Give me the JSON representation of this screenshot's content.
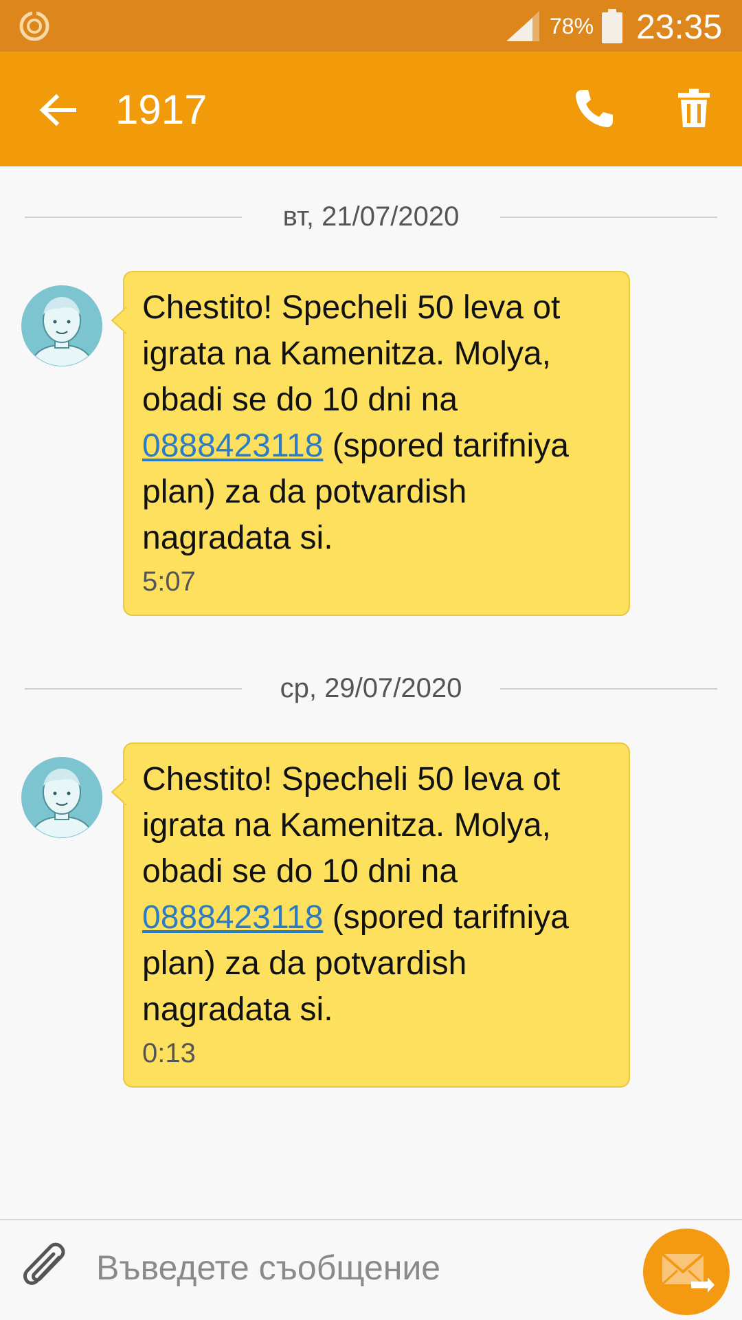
{
  "status_bar": {
    "battery": "78%",
    "time": "23:35",
    "icons": [
      "sync-icon",
      "signal-icon",
      "battery-icon"
    ]
  },
  "header": {
    "title": "1917",
    "icons": [
      "back-arrow-icon",
      "phone-icon",
      "trash-icon"
    ]
  },
  "conversation": [
    {
      "date": "вт, 21/07/2020",
      "text_before": "Chestito! Specheli 50 leva ot igrata na Kamenitza. Molya, obadi se do 10 dni na ",
      "link": "0888423118",
      "text_after": " (spored tarifniya plan) za da potvardish nagradata si.",
      "time": "5:07"
    },
    {
      "date": "ср, 29/07/2020",
      "text_before": "Chestito! Specheli 50 leva ot igrata na Kamenitza. Molya, obadi se do 10 dni na ",
      "link": "0888423118",
      "text_after": " (spored tarifniya plan) za da potvardish nagradata si.",
      "time": "0:13"
    }
  ],
  "composer": {
    "placeholder": "Въведете съобщение",
    "value": "",
    "icons": [
      "paperclip-icon",
      "send-message-icon"
    ]
  },
  "colors": {
    "status_bar": "#dd861b",
    "app_bar": "#f29b0a",
    "bubble": "#fde15e",
    "link": "#2a7cc7",
    "send_button": "#f39a12",
    "avatar": "#7cc4cf"
  }
}
